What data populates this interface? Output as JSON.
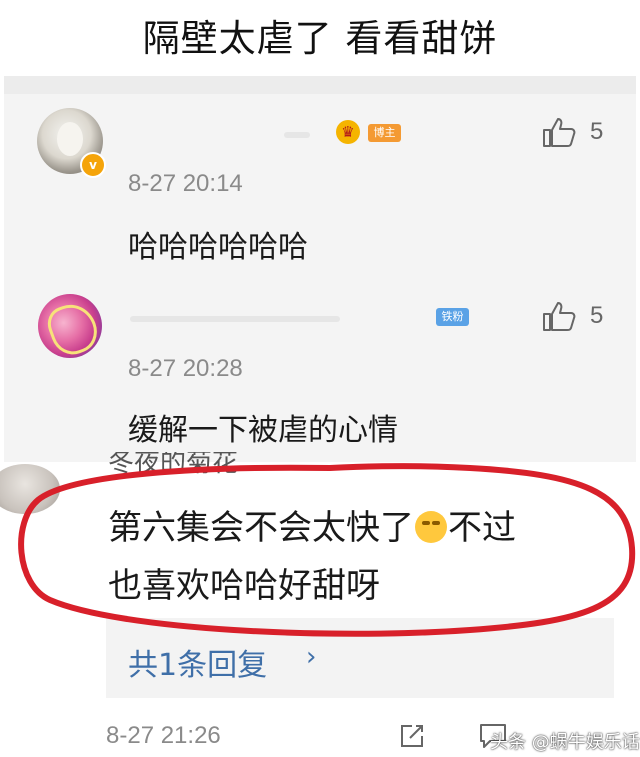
{
  "headline": "隔壁太虐了 看看甜饼",
  "comments": [
    {
      "tag": "博主",
      "likes": "5",
      "timestamp": "8-27 20:14",
      "text": "哈哈哈哈哈哈",
      "verified_badge": "v"
    },
    {
      "tag": "铁粉",
      "likes": "5",
      "timestamp": "8-27 20:28",
      "text": "缓解一下被虐的心情"
    }
  ],
  "highlighted_comment": {
    "partial_username": "冬夜的菊花",
    "text_line1_part1": "第六集会不会太快了",
    "text_line1_part2": "不过",
    "text_line2": "也喜欢哈哈好甜呀",
    "emoji": "flushed-face-emoji"
  },
  "replies": {
    "label": "共1条回复",
    "chevron": "›"
  },
  "footer": {
    "timestamp": "8-27 21:26",
    "watermark": "头条 @蜗牛娱乐话"
  },
  "colors": {
    "link": "#3f6fa8",
    "highlight_circle": "#d8202a",
    "tag_bozhu": "#f49a33",
    "tag_tiefen": "#5aa2e6",
    "crown": "#f5b400"
  },
  "icons": [
    "crown-icon",
    "thumbs-up-icon",
    "share-icon",
    "comment-icon",
    "verified-v-icon"
  ]
}
